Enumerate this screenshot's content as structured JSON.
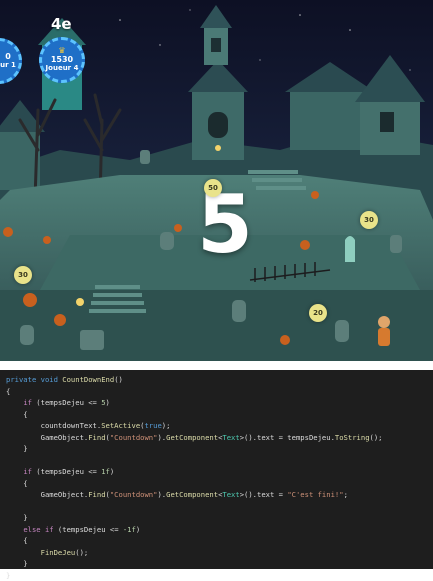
{
  "hud": {
    "left_player": {
      "rank": "",
      "score_partial": "0",
      "label_partial": "ur 1"
    },
    "right_player": {
      "rank": "4e",
      "score": "1530",
      "label": "Joueur 4"
    }
  },
  "countdown": {
    "value": "5"
  },
  "timers": [
    "50",
    "30",
    "30",
    "20"
  ],
  "code": {
    "lines": [
      [
        {
          "t": "private void ",
          "c": "kw"
        },
        {
          "t": "CountDownEnd",
          "c": "fn"
        },
        {
          "t": "()",
          "c": "id"
        }
      ],
      [
        {
          "t": "{",
          "c": "id"
        }
      ],
      [
        {
          "t": "    ",
          "c": "id"
        },
        {
          "t": "if",
          "c": "ctl"
        },
        {
          "t": " (tempsDejeu <= ",
          "c": "id"
        },
        {
          "t": "5",
          "c": "num"
        },
        {
          "t": ")",
          "c": "id"
        }
      ],
      [
        {
          "t": "    {",
          "c": "id"
        }
      ],
      [
        {
          "t": "        countdownText.",
          "c": "id"
        },
        {
          "t": "SetActive",
          "c": "fn"
        },
        {
          "t": "(",
          "c": "id"
        },
        {
          "t": "true",
          "c": "kw"
        },
        {
          "t": ");",
          "c": "id"
        }
      ],
      [
        {
          "t": "        GameObject.",
          "c": "id"
        },
        {
          "t": "Find",
          "c": "fn"
        },
        {
          "t": "(",
          "c": "id"
        },
        {
          "t": "\"Countdown\"",
          "c": "str"
        },
        {
          "t": ").",
          "c": "id"
        },
        {
          "t": "GetComponent",
          "c": "fn"
        },
        {
          "t": "<",
          "c": "id"
        },
        {
          "t": "Text",
          "c": "ty"
        },
        {
          "t": ">().text = tempsDejeu.",
          "c": "id"
        },
        {
          "t": "ToString",
          "c": "fn"
        },
        {
          "t": "();",
          "c": "id"
        }
      ],
      [
        {
          "t": "    }",
          "c": "id"
        }
      ],
      [
        {
          "t": "",
          "c": "id"
        }
      ],
      [
        {
          "t": "    ",
          "c": "id"
        },
        {
          "t": "if",
          "c": "ctl"
        },
        {
          "t": " (tempsDejeu <= ",
          "c": "id"
        },
        {
          "t": "1f",
          "c": "num"
        },
        {
          "t": ")",
          "c": "id"
        }
      ],
      [
        {
          "t": "    {",
          "c": "id"
        }
      ],
      [
        {
          "t": "        GameObject.",
          "c": "id"
        },
        {
          "t": "Find",
          "c": "fn"
        },
        {
          "t": "(",
          "c": "id"
        },
        {
          "t": "\"Countdown\"",
          "c": "str"
        },
        {
          "t": ").",
          "c": "id"
        },
        {
          "t": "GetComponent",
          "c": "fn"
        },
        {
          "t": "<",
          "c": "id"
        },
        {
          "t": "Text",
          "c": "ty"
        },
        {
          "t": ">().text = ",
          "c": "id"
        },
        {
          "t": "\"C'est fini!\"",
          "c": "str"
        },
        {
          "t": ";",
          "c": "id"
        }
      ],
      [
        {
          "t": "",
          "c": "id"
        }
      ],
      [
        {
          "t": "    }",
          "c": "id"
        }
      ],
      [
        {
          "t": "    ",
          "c": "id"
        },
        {
          "t": "else if",
          "c": "ctl"
        },
        {
          "t": " (tempsDejeu <= ",
          "c": "id"
        },
        {
          "t": "-1f",
          "c": "num"
        },
        {
          "t": ")",
          "c": "id"
        }
      ],
      [
        {
          "t": "    {",
          "c": "id"
        }
      ],
      [
        {
          "t": "        ",
          "c": "id"
        },
        {
          "t": "FinDeJeu",
          "c": "fn"
        },
        {
          "t": "();",
          "c": "id"
        }
      ],
      [
        {
          "t": "    }",
          "c": "id"
        }
      ],
      [
        {
          "t": "}",
          "c": "id"
        }
      ]
    ]
  }
}
